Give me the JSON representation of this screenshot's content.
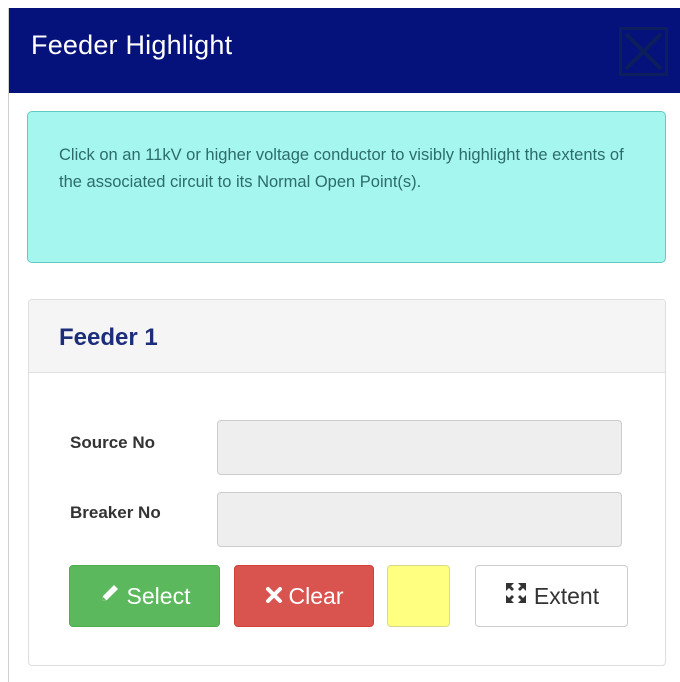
{
  "dialog": {
    "title": "Feeder Highlight",
    "close_icon": "close-icon",
    "colors": {
      "titlebar": "#06127b",
      "info_bg": "#a6f6f0",
      "info_text": "#2c6c6a"
    }
  },
  "info": {
    "message": "Click on an 11kV or higher voltage conductor to visibly highlight the extents of the associated circuit to its Normal Open Point(s)."
  },
  "feeder": {
    "title": "Feeder 1",
    "source_label": "Source No",
    "source_value": "",
    "breaker_label": "Breaker No",
    "breaker_value": "",
    "buttons": {
      "select_label": "Select",
      "select_icon": "pencil-icon",
      "clear_label": "Clear",
      "clear_icon": "x-icon",
      "extent_label": "Extent",
      "extent_icon": "expand-icon",
      "highlight_color": "#ffff80"
    }
  }
}
